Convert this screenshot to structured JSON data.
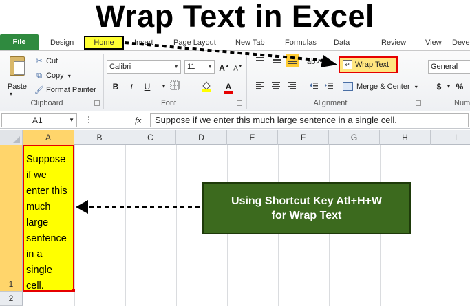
{
  "headline": "Wrap Text in Excel",
  "tabs": [
    "File",
    "Design",
    "Home",
    "Insert",
    "Page Layout",
    "New Tab",
    "Formulas",
    "Data",
    "Review",
    "View",
    "Deve"
  ],
  "clipboard": {
    "paste": "Paste",
    "cut": "Cut",
    "copy": "Copy",
    "copy_dd": "▾",
    "format_painter": "Format Painter",
    "group": "Clipboard"
  },
  "font": {
    "name": "Calibri",
    "size": "11",
    "bold": "B",
    "italic": "I",
    "underline": "U",
    "fill_color": "#ffff00",
    "font_color": "#e60000",
    "group": "Font"
  },
  "alignment": {
    "wrap_text": "Wrap Text",
    "merge_center": "Merge & Center",
    "group": "Alignment"
  },
  "number": {
    "format": "General",
    "currency": "$",
    "percent": "%",
    "comma": ",",
    "group": "Num"
  },
  "formula_bar": {
    "name_box": "A1",
    "fx": "fx",
    "value": "Suppose if we enter this much large sentence in a single cell."
  },
  "grid": {
    "columns": [
      "A",
      "B",
      "C",
      "D",
      "E",
      "F",
      "G",
      "H",
      "I"
    ],
    "rows": [
      "1",
      "2"
    ],
    "a1_lines": [
      "Suppose",
      "if we",
      "enter this",
      "much",
      "large",
      "sentence",
      "in a",
      "single",
      "cell."
    ]
  },
  "callout": {
    "line1": "Using Shortcut Key Atl+H+W",
    "line2": "for Wrap Text"
  },
  "colors": {
    "highlight": "#ffff33",
    "annotation_red": "#e60000",
    "callout_green": "#3c6a1e",
    "file_tab_green": "#2f8a3f"
  }
}
